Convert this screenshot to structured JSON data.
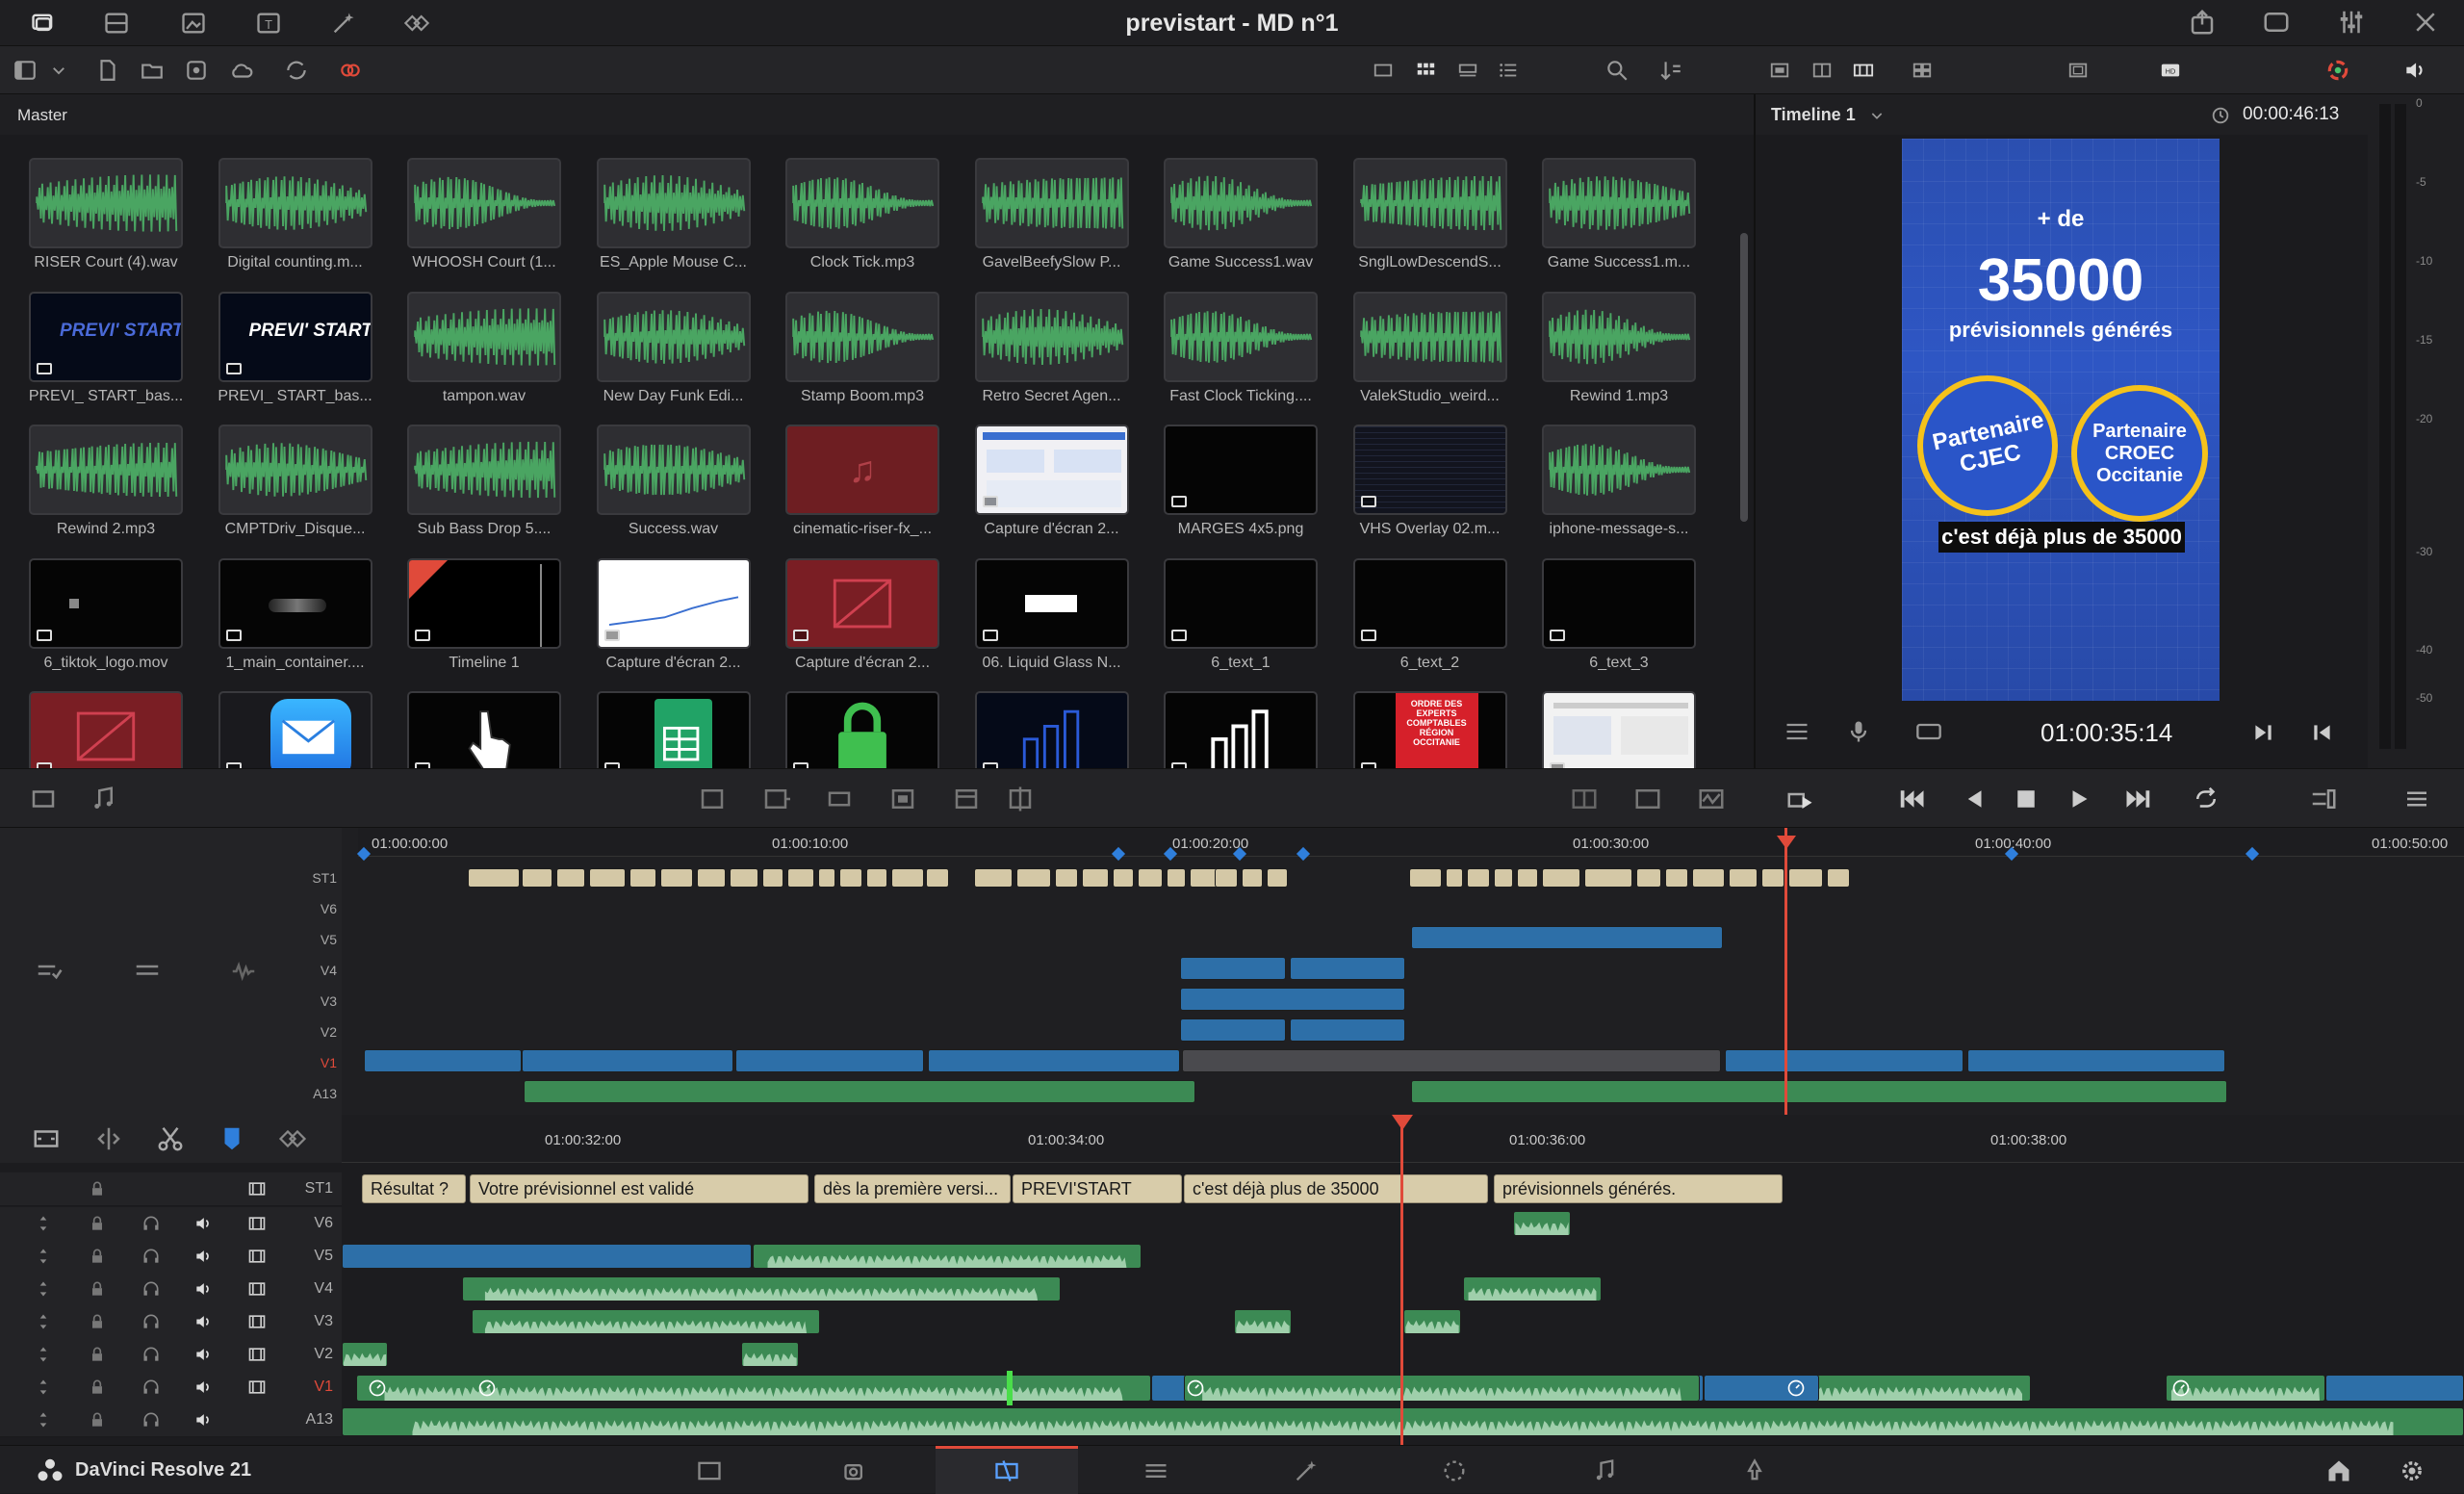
{
  "app": {
    "name": "DaVinci Resolve 21",
    "project_title": "previstart - MD n°1"
  },
  "media_pool": {
    "bin": "Master",
    "clips": [
      {
        "name": "RISER Court (4).wav",
        "kind": "audio"
      },
      {
        "name": "Digital counting.m...",
        "kind": "audio"
      },
      {
        "name": "WHOOSH Court (1...",
        "kind": "audio"
      },
      {
        "name": "ES_Apple Mouse C...",
        "kind": "audio"
      },
      {
        "name": "Clock Tick.mp3",
        "kind": "audio"
      },
      {
        "name": "GavelBeefySlow P...",
        "kind": "audio"
      },
      {
        "name": "Game Success1.wav",
        "kind": "audio"
      },
      {
        "name": "SnglLowDescendS...",
        "kind": "audio"
      },
      {
        "name": "Game Success1.m...",
        "kind": "audio"
      },
      {
        "name": "PREVI_ START_bas...",
        "kind": "image",
        "label": "PREVI' START"
      },
      {
        "name": "PREVI_ START_bas...",
        "kind": "image",
        "label": "PREVI' START"
      },
      {
        "name": "tampon.wav",
        "kind": "audio"
      },
      {
        "name": "New Day Funk Edi...",
        "kind": "audio"
      },
      {
        "name": "Stamp Boom.mp3",
        "kind": "audio"
      },
      {
        "name": "Retro Secret Agen...",
        "kind": "audio"
      },
      {
        "name": "Fast Clock Ticking....",
        "kind": "audio"
      },
      {
        "name": "ValekStudio_weird...",
        "kind": "audio"
      },
      {
        "name": "Rewind 1.mp3",
        "kind": "audio"
      },
      {
        "name": "Rewind 2.mp3",
        "kind": "audio"
      },
      {
        "name": "CMPTDriv_Disque...",
        "kind": "audio"
      },
      {
        "name": "Sub Bass Drop 5....",
        "kind": "audio"
      },
      {
        "name": "Success.wav",
        "kind": "audio"
      },
      {
        "name": "cinematic-riser-fx_...",
        "kind": "audio-red"
      },
      {
        "name": "Capture d'écran 2...",
        "kind": "screenshot"
      },
      {
        "name": "MARGES 4x5.png",
        "kind": "black"
      },
      {
        "name": "VHS Overlay 02.m...",
        "kind": "dark"
      },
      {
        "name": "iphone-message-s...",
        "kind": "audio"
      },
      {
        "name": "6_tiktok_logo.mov",
        "kind": "black"
      },
      {
        "name": "1_main_container....",
        "kind": "black"
      },
      {
        "name": "Timeline 1",
        "kind": "timeline"
      },
      {
        "name": "Capture d'écran 2...",
        "kind": "chartshot"
      },
      {
        "name": "Capture d'écran 2...",
        "kind": "red"
      },
      {
        "name": "06. Liquid Glass N...",
        "kind": "black"
      },
      {
        "name": "6_text_1",
        "kind": "black"
      },
      {
        "name": "6_text_2",
        "kind": "black"
      },
      {
        "name": "6_text_3",
        "kind": "black"
      },
      {
        "name": "",
        "kind": "red"
      },
      {
        "name": "",
        "kind": "mail"
      },
      {
        "name": "",
        "kind": "hand"
      },
      {
        "name": "",
        "kind": "sheets"
      },
      {
        "name": "",
        "kind": "lock"
      },
      {
        "name": "",
        "kind": "bluelogo"
      },
      {
        "name": "",
        "kind": "whitelogo"
      },
      {
        "name": "",
        "kind": "poster",
        "label": "ORDRE DES EXPERTS COMPTABLES RÉGION OCCITANIE"
      },
      {
        "name": "",
        "kind": "doc"
      }
    ]
  },
  "viewer": {
    "timeline_name": "Timeline 1",
    "duration_tc": "00:00:46:13",
    "current_tc": "01:00:35:14",
    "preview": {
      "line1": "+ de",
      "line2": "35000",
      "line3": "prévisionnels générés",
      "badge1": "Partenaire CJEC",
      "badge2": "Partenaire CROEC Occitanie",
      "caption": "c'est déjà plus de 35000"
    }
  },
  "meters": {
    "ticks": [
      "0",
      "-5",
      "-10",
      "-15",
      "-20",
      "-30",
      "-40",
      "-50"
    ]
  },
  "upper_timeline": {
    "ruler": [
      "01:00:00:00",
      "01:00:10:00",
      "01:00:20:00",
      "01:00:30:00",
      "01:00:40:00",
      "01:00:50:00"
    ],
    "tracks": [
      "ST1",
      "V6",
      "V5",
      "V4",
      "V3",
      "V2",
      "V1",
      "A13"
    ]
  },
  "lower_timeline": {
    "ruler": [
      "01:00:32:00",
      "01:00:34:00",
      "01:00:36:00",
      "01:00:38:00"
    ],
    "tracks": [
      "ST1",
      "V6",
      "V5",
      "V4",
      "V3",
      "V2",
      "V1",
      "A13"
    ],
    "captions": [
      {
        "text": "Résultat ?"
      },
      {
        "text": "Votre prévisionnel est validé"
      },
      {
        "text": "dès la première versi..."
      },
      {
        "text": "PREVI'START"
      },
      {
        "text": "c'est déjà plus de 35000"
      },
      {
        "text": "prévisionnels générés."
      }
    ]
  },
  "colors": {
    "accent": "#e04a3a",
    "video_clip": "#2d6fa8",
    "audio_clip": "#3c8a54",
    "subtitle_clip": "#d8ccaa",
    "badge_ring": "#f5c21b"
  }
}
